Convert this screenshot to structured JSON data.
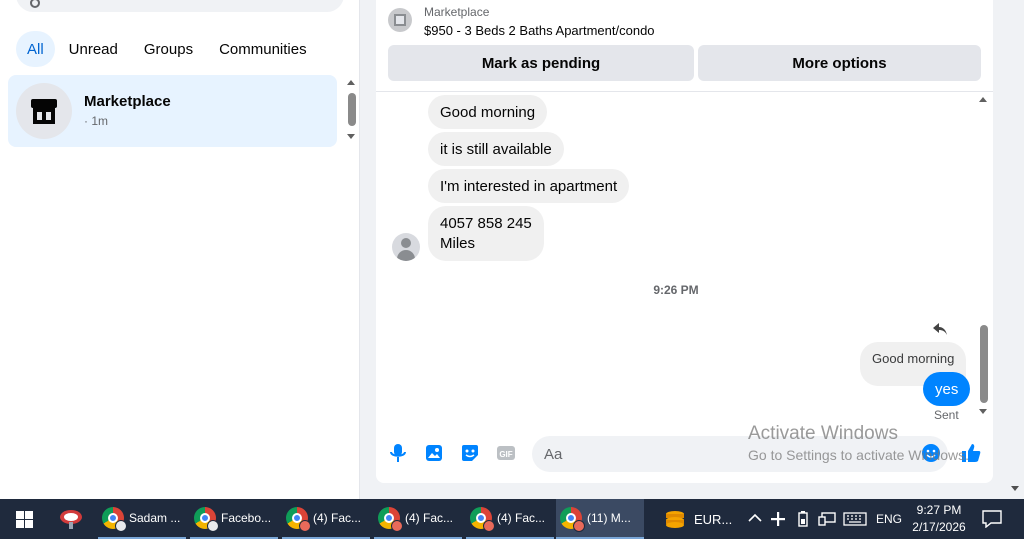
{
  "left_panel": {
    "filters": [
      "All",
      "Unread",
      "Groups",
      "Communities"
    ],
    "conversation": {
      "name": "Marketplace",
      "time": "· 1m"
    }
  },
  "listing": {
    "category": "Marketplace",
    "title": "$950 - 3 Beds 2 Baths Apartment/condo",
    "mark_pending": "Mark as pending",
    "more_options": "More options"
  },
  "messages": {
    "received": [
      "Good morning",
      "it is still available",
      "I'm interested in apartment"
    ],
    "received_multiline": [
      "4057 858 245",
      "Miles"
    ],
    "timestamp": "9:26 PM",
    "quoted": "Good morning",
    "sent": "yes",
    "status": "Sent"
  },
  "composer": {
    "placeholder": "Aa"
  },
  "watermark": {
    "line1": "Activate Windows",
    "line2": "Go to Settings to activate Windows."
  },
  "taskbar": {
    "apps": [
      "Sadam ...",
      "Facebo...",
      "(4) Fac...",
      "(4) Fac...",
      "(4) Fac...",
      "(11) M..."
    ],
    "currency": "EUR...",
    "language": "ENG",
    "time": "9:27 PM",
    "date": "2/17/2026"
  },
  "colors": {
    "accent": "#0084ff",
    "selected_bg": "#e7f3ff",
    "taskbar": "#1f2a3d"
  }
}
